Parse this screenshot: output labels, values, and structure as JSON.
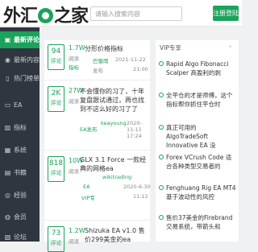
{
  "header": {
    "logo_left": "外汇",
    "logo_right": "之家",
    "search_placeholder": "请输入搜索内容",
    "register_label": "注册登陆"
  },
  "sidebar": {
    "items": [
      {
        "icon": "▣",
        "label": "最新评论",
        "active": true
      },
      {
        "icon": "◉",
        "label": "最新内容",
        "active": false
      },
      {
        "icon": "▯",
        "label": "热门榜单",
        "active": false
      },
      {
        "icon": "▭",
        "label": "EA",
        "active": false
      },
      {
        "icon": "▥",
        "label": "指标",
        "active": false
      },
      {
        "icon": "▦",
        "label": "系统",
        "active": false
      },
      {
        "icon": "▤",
        "label": "书籍",
        "active": false
      },
      {
        "icon": "◎",
        "label": "经验",
        "active": false
      },
      {
        "icon": "◍",
        "label": "会员",
        "active": false
      },
      {
        "icon": "▧",
        "label": "论坛",
        "active": false
      }
    ]
  },
  "posts": [
    {
      "count": "94",
      "count_label": "评论",
      "reads": "1.7W",
      "reads_label": "阅读",
      "title": "分形价格指标",
      "tag": "指标",
      "user": "巴蜀雨",
      "time": "2021-11-22",
      "site": "发布",
      "date2": "21:00"
    },
    {
      "count": "2K",
      "count_label": "评论",
      "reads": "27W",
      "reads_label": "阅读",
      "title": "不会懂你的习了，十年复盘跟试通过，再也找到不这么好的习了了",
      "tag": "EA发布",
      "user": "keayoung",
      "time": "2020-11-11 17:24",
      "site": "",
      "date2": ""
    },
    {
      "count": "818",
      "count_label": "评论",
      "reads": "10W",
      "reads_label": "阅读",
      "title": "GLX 3.1 Force 一款经典的网格ea",
      "tag": "EA",
      "user": "wikitrading",
      "time": "2020-6-30",
      "site": "VIP专",
      "date2": "11:12"
    },
    {
      "count": "73",
      "count_label": "评论",
      "reads": "1.2W",
      "reads_label": "阅读",
      "title": "Shizuka EA v1.0 售价299美金的ea",
      "tag": "",
      "user": "",
      "time": "",
      "site": "",
      "date2": ""
    }
  ],
  "right_panel": {
    "heading": "VIP专享",
    "more": "›",
    "items": [
      "Rapid Algo Fibonacci Scalper 高盈利的剥",
      "全平仓的才是师傅，这个指标帮你抓住平仓时",
      "真正可用的AlgoTradeSoft Innovative EA 没",
      "Forex VCrush Code 适合各种类型交易者的",
      "Fenghuang Rig EA MT4 基于波动性的风控 ",
      "售价37美金的Firebrand交易系统，带箭头和"
    ]
  },
  "colors": {
    "accent": "#1aa35a",
    "sidebar_bg": "#2f3640",
    "tag": "#e67e22"
  }
}
